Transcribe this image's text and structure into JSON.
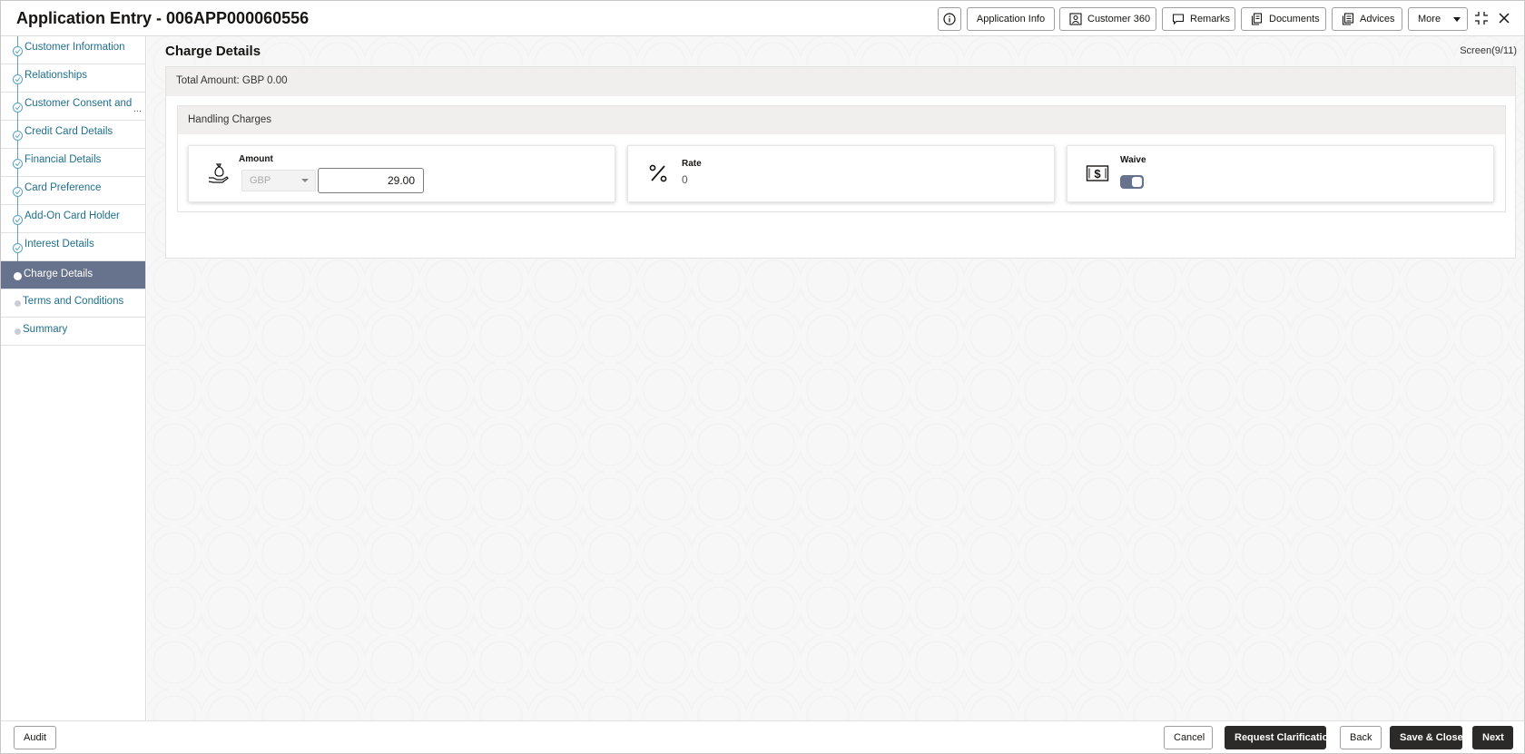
{
  "header": {
    "title": "Application Entry - 006APP000060556",
    "buttons": {
      "application_info": "Application Info",
      "customer_360": "Customer 360",
      "remarks": "Remarks",
      "documents": "Documents",
      "advices": "Advices",
      "more": "More"
    }
  },
  "sidebar": {
    "items": [
      {
        "label": "Customer Information",
        "state": "done"
      },
      {
        "label": "Relationships",
        "state": "done"
      },
      {
        "label": "Customer Consent and",
        "state": "done",
        "truncated": "..."
      },
      {
        "label": "Credit Card Details",
        "state": "done"
      },
      {
        "label": "Financial Details",
        "state": "done"
      },
      {
        "label": "Card Preference",
        "state": "done"
      },
      {
        "label": "Add-On Card Holder",
        "state": "done"
      },
      {
        "label": "Interest Details",
        "state": "done"
      },
      {
        "label": "Charge Details",
        "state": "active"
      },
      {
        "label": "Terms and Conditions",
        "state": "pending"
      },
      {
        "label": "Summary",
        "state": "pending"
      }
    ]
  },
  "main": {
    "title": "Charge Details",
    "screen_counter": "Screen(9/11)",
    "total_amount": "Total Amount: GBP 0.00",
    "handling_charges": {
      "title": "Handling Charges",
      "amount": {
        "label": "Amount",
        "currency": "GBP",
        "value": "29.00"
      },
      "rate": {
        "label": "Rate",
        "value": "0"
      },
      "waive": {
        "label": "Waive",
        "on": true
      }
    }
  },
  "footer": {
    "audit": "Audit",
    "cancel": "Cancel",
    "request_clarification": "Request Clarification",
    "back": "Back",
    "save_close": "Save & Close",
    "next": "Next"
  },
  "colors": {
    "accent_active": "#67728c",
    "link": "#1f6e8c",
    "primary_button": "#2b2a28"
  }
}
